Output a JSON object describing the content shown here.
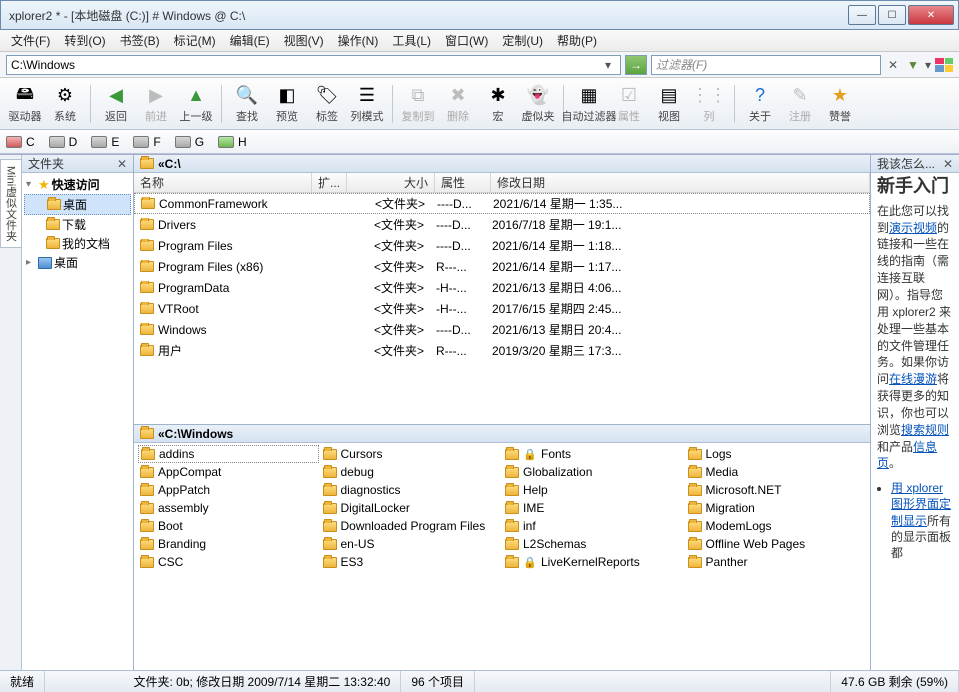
{
  "window": {
    "title": "xplorer2 * - [本地磁盘 (C:)] # Windows @ C:\\"
  },
  "menu": [
    "文件(F)",
    "转到(O)",
    "书签(B)",
    "标记(M)",
    "编辑(E)",
    "视图(V)",
    "操作(N)",
    "工具(L)",
    "窗口(W)",
    "定制(U)",
    "帮助(P)"
  ],
  "address": {
    "path": "C:\\Windows",
    "filter_placeholder": "过滤器(F)"
  },
  "toolbar": [
    {
      "label": "驱动器",
      "icon": "🖴",
      "enabled": true
    },
    {
      "label": "系统",
      "icon": "⚙",
      "enabled": true
    },
    {
      "sep": true
    },
    {
      "label": "返回",
      "icon": "◀",
      "enabled": true,
      "color": "#3a9a3a"
    },
    {
      "label": "前进",
      "icon": "▶",
      "enabled": false,
      "color": "#bdbdbd"
    },
    {
      "label": "上一级",
      "icon": "▲",
      "enabled": true,
      "color": "#3a9a3a"
    },
    {
      "sep": true
    },
    {
      "label": "查找",
      "icon": "🔍",
      "enabled": true
    },
    {
      "label": "预览",
      "icon": "◧",
      "enabled": true
    },
    {
      "label": "标签",
      "icon": "🏷",
      "enabled": true
    },
    {
      "label": "列模式",
      "icon": "☰",
      "enabled": true
    },
    {
      "sep": true
    },
    {
      "label": "复制到",
      "icon": "⧉",
      "enabled": false
    },
    {
      "label": "删除",
      "icon": "✖",
      "enabled": false
    },
    {
      "label": "宏",
      "icon": "✱",
      "enabled": true
    },
    {
      "label": "虚似夹",
      "icon": "👻",
      "enabled": true
    },
    {
      "sep": true
    },
    {
      "label": "自动过滤器",
      "icon": "▦",
      "enabled": true
    },
    {
      "label": "属性",
      "icon": "☑",
      "enabled": false
    },
    {
      "label": "视图",
      "icon": "▤",
      "enabled": true
    },
    {
      "label": "列",
      "icon": "⋮⋮",
      "enabled": false
    },
    {
      "sep": true
    },
    {
      "label": "关于",
      "icon": "?",
      "enabled": true,
      "color": "#1a6fd1"
    },
    {
      "label": "注册",
      "icon": "✎",
      "enabled": false
    },
    {
      "label": "赞誉",
      "icon": "★",
      "enabled": true,
      "color": "#e0a020"
    }
  ],
  "drives": [
    "C",
    "D",
    "E",
    "F",
    "G",
    "H"
  ],
  "vertical_tab": "Mini虚似文件夹",
  "tree": {
    "header": "文件夹",
    "quick": {
      "label": "快速访问",
      "children": [
        "桌面",
        "下载",
        "我的文档"
      ]
    },
    "desktop": "桌面"
  },
  "upper": {
    "path": "«C:\\",
    "columns": {
      "name": "名称",
      "ext": "扩...",
      "size": "大小",
      "attr": "属性",
      "mdate": "修改日期"
    },
    "rows": [
      {
        "name": "CommonFramework",
        "size": "<文件夹>",
        "attr": "----D...",
        "mdate": "2021/6/14 星期一 1:35...",
        "sel": true
      },
      {
        "name": "Drivers",
        "size": "<文件夹>",
        "attr": "----D...",
        "mdate": "2016/7/18 星期一 19:1..."
      },
      {
        "name": "Program Files",
        "size": "<文件夹>",
        "attr": "----D...",
        "mdate": "2021/6/14 星期一 1:18..."
      },
      {
        "name": "Program Files (x86)",
        "size": "<文件夹>",
        "attr": "R---...",
        "mdate": "2021/6/14 星期一 1:17..."
      },
      {
        "name": "ProgramData",
        "size": "<文件夹>",
        "attr": "-H--...",
        "mdate": "2021/6/13 星期日 4:06..."
      },
      {
        "name": "VTRoot",
        "size": "<文件夹>",
        "attr": "-H--...",
        "mdate": "2017/6/15 星期四 2:45..."
      },
      {
        "name": "Windows",
        "size": "<文件夹>",
        "attr": "----D...",
        "mdate": "2021/6/13 星期日 20:4..."
      },
      {
        "name": "用户",
        "size": "<文件夹>",
        "attr": "R---...",
        "mdate": "2019/3/20 星期三 17:3..."
      }
    ]
  },
  "lower": {
    "path": "«C:\\Windows",
    "items": [
      {
        "n": "addins",
        "sel": true
      },
      {
        "n": "AppCompat"
      },
      {
        "n": "AppPatch"
      },
      {
        "n": "assembly"
      },
      {
        "n": "Boot"
      },
      {
        "n": "Branding"
      },
      {
        "n": "CSC"
      },
      {
        "n": "Cursors"
      },
      {
        "n": "debug"
      },
      {
        "n": "diagnostics"
      },
      {
        "n": "DigitalLocker"
      },
      {
        "n": "Downloaded Program Files"
      },
      {
        "n": "en-US"
      },
      {
        "n": "ES3"
      },
      {
        "n": "Fonts",
        "lock": true
      },
      {
        "n": "Globalization"
      },
      {
        "n": "Help"
      },
      {
        "n": "IME"
      },
      {
        "n": "inf"
      },
      {
        "n": "L2Schemas"
      },
      {
        "n": "LiveKernelReports",
        "lock": true
      },
      {
        "n": "Logs"
      },
      {
        "n": "Media"
      },
      {
        "n": "Microsoft.NET"
      },
      {
        "n": "Migration"
      },
      {
        "n": "ModemLogs"
      },
      {
        "n": "Offline Web Pages"
      },
      {
        "n": "Panther"
      }
    ]
  },
  "help": {
    "header": "我该怎么...",
    "title": "新手入门",
    "p1": "在此您可以找到",
    "l1": "演示视频",
    "p1b": "的链接和一些在线的指南（需连接互联网）。指导您用 xplorer2 来处理一些基本的文件管理任务。如果你访问",
    "l2": "在线漫游",
    "p2": "将获得更多的知识，你也可以浏览",
    "l3": "搜索规则",
    "p2b": "和产品",
    "l4": "信息页",
    "p3": "。",
    "bullet_l": "用 xplorer 图形界面定制显示",
    "bullet_t": "所有的显示面板都"
  },
  "status": {
    "ready": "就绪",
    "detail": "文件夹: 0b; 修改日期 2009/7/14 星期二 13:32:40",
    "count": "96 个项目",
    "disk": "47.6 GB 剩余 (59%)"
  }
}
